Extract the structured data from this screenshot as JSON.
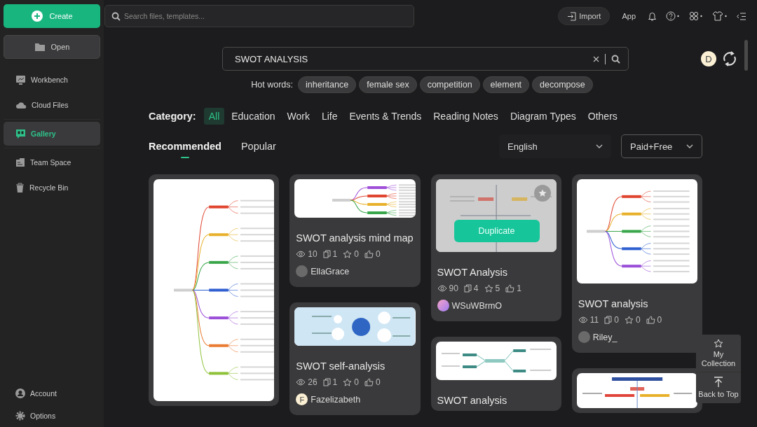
{
  "sidebar": {
    "create_button": "Create",
    "open_button": "Open",
    "items": [
      {
        "label": "Workbench",
        "selected": false
      },
      {
        "label": "Cloud Files",
        "selected": false
      },
      {
        "label": "Gallery",
        "selected": true
      },
      {
        "label": "Team Space",
        "selected": false
      },
      {
        "label": "Recycle Bin",
        "selected": false
      }
    ],
    "bottom_items": [
      {
        "label": "Account"
      },
      {
        "label": "Options"
      }
    ]
  },
  "topbar": {
    "search_placeholder": "Search files, templates...",
    "import_button": "Import",
    "app_link": "App"
  },
  "gallery_search": {
    "value": "SWOT ANALYSIS",
    "user_initial": "D"
  },
  "hot_words": {
    "label": "Hot words:",
    "words": [
      "inheritance",
      "female sex",
      "competition",
      "element",
      "decompose"
    ]
  },
  "category": {
    "label": "Category:",
    "items": [
      {
        "label": "All",
        "selected": true
      },
      {
        "label": "Education",
        "selected": false
      },
      {
        "label": "Work",
        "selected": false
      },
      {
        "label": "Life",
        "selected": false
      },
      {
        "label": "Events & Trends",
        "selected": false
      },
      {
        "label": "Reading Notes",
        "selected": false
      },
      {
        "label": "Diagram Types",
        "selected": false
      },
      {
        "label": "Others",
        "selected": false
      }
    ]
  },
  "sort_tabs": [
    {
      "label": "Recommended",
      "selected": true
    },
    {
      "label": "Popular",
      "selected": false
    }
  ],
  "filters": [
    {
      "value": "English",
      "kind": "plain"
    },
    {
      "value": "Paid+Free",
      "kind": "outlined"
    }
  ],
  "columns": [
    [
      {
        "kind": "tall",
        "hovered": false
      }
    ],
    [
      {
        "kind": "wide",
        "hovered": false,
        "title": "SWOT analysis mind map",
        "views": "10",
        "duplicates": "1",
        "favorites": "0",
        "likes": "0",
        "author": "EllaGrace",
        "avatar": {
          "kind": "photo"
        }
      },
      {
        "kind": "bubble",
        "hovered": false,
        "title": "SWOT self-analysis",
        "views": "26",
        "duplicates": "1",
        "favorites": "0",
        "likes": "0",
        "author": "Fazelizabeth",
        "avatar": {
          "kind": "letter",
          "letter": "F"
        }
      }
    ],
    [
      {
        "kind": "quadrant",
        "hovered": true,
        "duplicate_button": "Duplicate",
        "title": "SWOT Analysis",
        "views": "90",
        "duplicates": "4",
        "favorites": "5",
        "likes": "1",
        "author": "WSuWBrmO",
        "avatar": {
          "kind": "gradient"
        }
      },
      {
        "kind": "tree",
        "hovered": false,
        "title": "SWOT analysis"
      }
    ],
    [
      {
        "kind": "medium",
        "hovered": false,
        "title": "SWOT analysis",
        "views": "11",
        "duplicates": "0",
        "favorites": "0",
        "likes": "0",
        "author": "Riley_",
        "avatar": {
          "kind": "photo"
        }
      },
      {
        "kind": "org",
        "hovered": false
      }
    ]
  ],
  "float_panel": [
    {
      "label": "My Collection"
    },
    {
      "label": "Back to Top"
    }
  ]
}
